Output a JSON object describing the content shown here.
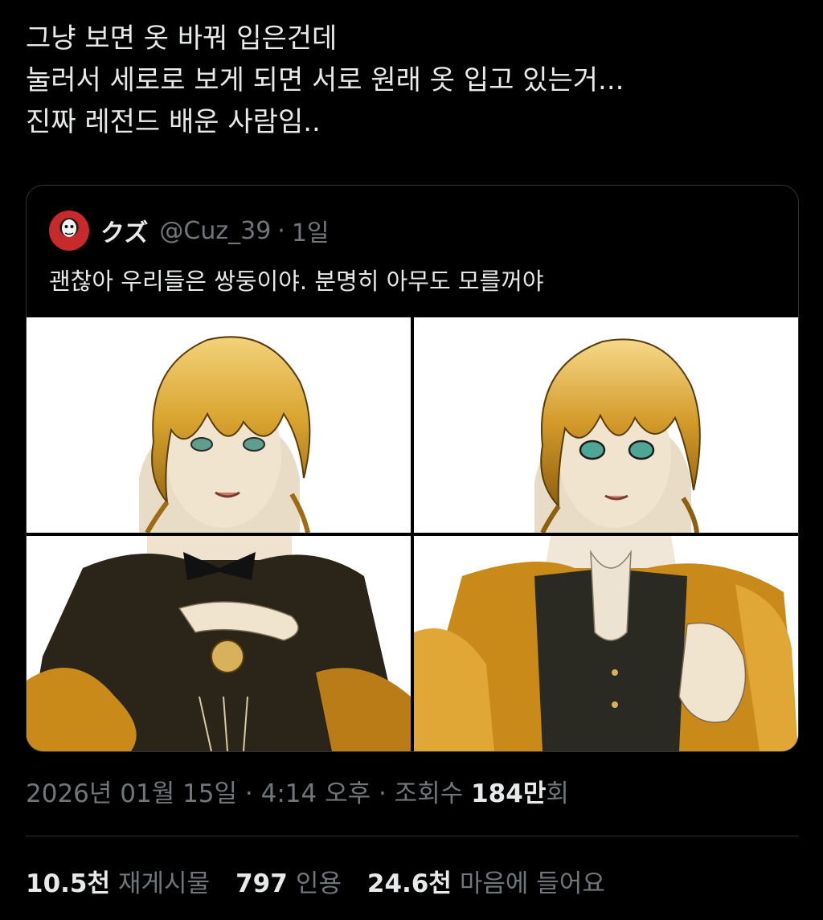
{
  "tweet": {
    "lines": [
      "그냥 보면 옷 바꿔 입은건데",
      "눌러서 세로로 보게 되면 서로 원래 옷 입고 있는거...",
      "진짜 레전드 배운 사람임.."
    ]
  },
  "quoted_tweet": {
    "author_name": "クズ",
    "handle": "@Cuz_39",
    "separator": "·",
    "time": "1일",
    "text": "괜찮아 우리들은 쌍둥이야. 분명히 아무도 모를꺼야",
    "media": [
      {
        "name": "image-top-left"
      },
      {
        "name": "image-top-right"
      },
      {
        "name": "image-bottom-left"
      },
      {
        "name": "image-bottom-right"
      }
    ]
  },
  "meta": {
    "datetime": "2026년 01월 15일 · 4:14 오후 · 조회수 ",
    "views_number": "184만",
    "views_suffix": "회"
  },
  "stats": {
    "reposts_count": "10.5천",
    "reposts_label": "재게시물",
    "quotes_count": "797",
    "quotes_label": "인용",
    "likes_count": "24.6천",
    "likes_label": "마음에 들어요"
  },
  "colors": {
    "background": "#000000",
    "text_primary": "#e7e9ea",
    "text_secondary": "#71767b",
    "border": "#2f3336",
    "hair_gold": "#d9a430"
  }
}
